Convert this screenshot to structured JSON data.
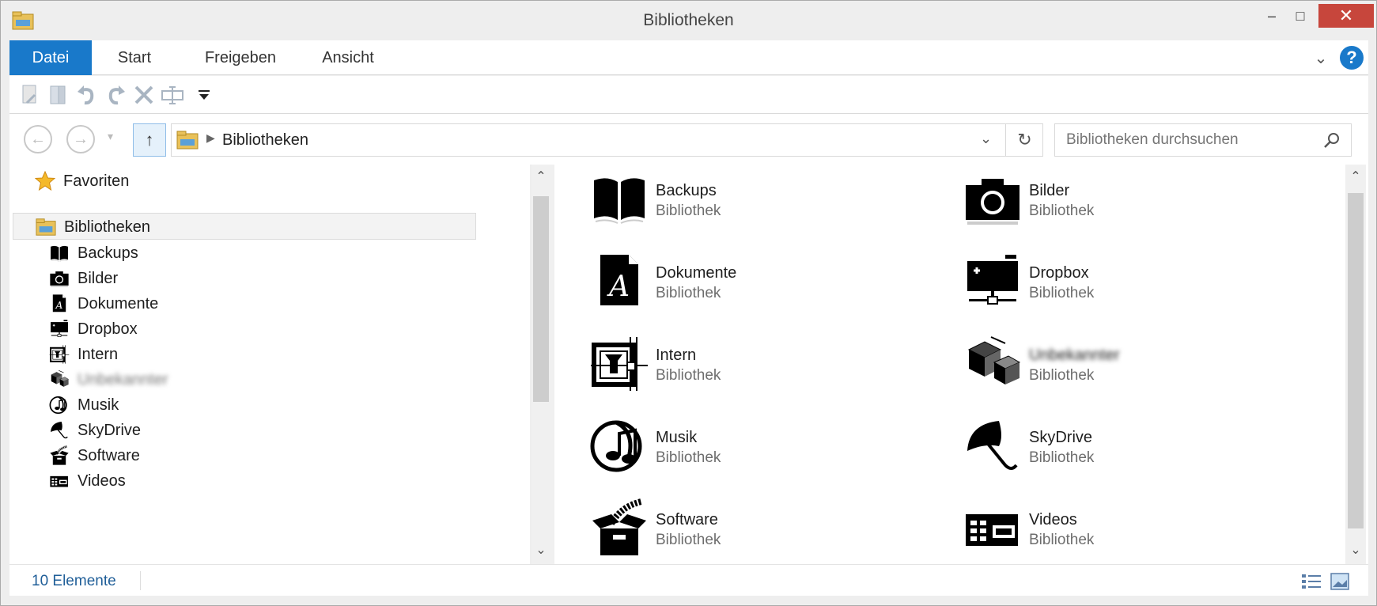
{
  "window": {
    "title": "Bibliotheken",
    "controls": {
      "minimize": "–",
      "maximize": "□",
      "close": "✕"
    }
  },
  "ribbon": {
    "tabs": [
      {
        "label": "Datei",
        "active": true
      },
      {
        "label": "Start"
      },
      {
        "label": "Freigeben"
      },
      {
        "label": "Ansicht"
      }
    ],
    "expand_icon": "chevron-down-icon",
    "help_label": "?"
  },
  "quick_access": {
    "buttons": [
      "properties-icon",
      "new-folder-icon",
      "undo-icon",
      "redo-icon",
      "delete-icon",
      "rename-icon",
      "customize-dropdown-icon"
    ]
  },
  "navigation": {
    "back": "←",
    "forward": "→",
    "up": "↑",
    "breadcrumb": [
      "Bibliotheken"
    ],
    "search_placeholder": "Bibliotheken durchsuchen"
  },
  "nav_pane": {
    "favorites_label": "Favoriten",
    "libraries_label": "Bibliotheken",
    "items": [
      {
        "label": "Backups",
        "icon": "book-icon"
      },
      {
        "label": "Bilder",
        "icon": "camera-icon"
      },
      {
        "label": "Dokumente",
        "icon": "document-icon"
      },
      {
        "label": "Dropbox",
        "icon": "dropbox-icon"
      },
      {
        "label": "Intern",
        "icon": "intern-icon"
      },
      {
        "label": "Unbekannter",
        "icon": "cubes-icon",
        "blurred": true
      },
      {
        "label": "Musik",
        "icon": "music-icon"
      },
      {
        "label": "SkyDrive",
        "icon": "umbrella-icon"
      },
      {
        "label": "Software",
        "icon": "software-box-icon"
      },
      {
        "label": "Videos",
        "icon": "video-icon"
      }
    ]
  },
  "content": {
    "libraries": [
      {
        "name": "Backups",
        "type": "Bibliothek",
        "icon": "book-icon"
      },
      {
        "name": "Bilder",
        "type": "Bibliothek",
        "icon": "camera-icon"
      },
      {
        "name": "Dokumente",
        "type": "Bibliothek",
        "icon": "document-icon"
      },
      {
        "name": "Dropbox",
        "type": "Bibliothek",
        "icon": "dropbox-icon"
      },
      {
        "name": "Intern",
        "type": "Bibliothek",
        "icon": "intern-icon"
      },
      {
        "name": "Unbekannter",
        "type": "Bibliothek",
        "icon": "cubes-icon",
        "blurred": true
      },
      {
        "name": "Musik",
        "type": "Bibliothek",
        "icon": "music-icon"
      },
      {
        "name": "SkyDrive",
        "type": "Bibliothek",
        "icon": "umbrella-icon"
      },
      {
        "name": "Software",
        "type": "Bibliothek",
        "icon": "software-box-icon"
      },
      {
        "name": "Videos",
        "type": "Bibliothek",
        "icon": "video-icon"
      }
    ]
  },
  "status": {
    "count": "10 Elemente"
  },
  "colors": {
    "accent": "#1979ca",
    "close": "#c7463c",
    "status_text": "#1f5e98",
    "secondary_text": "#6d6d6d"
  }
}
